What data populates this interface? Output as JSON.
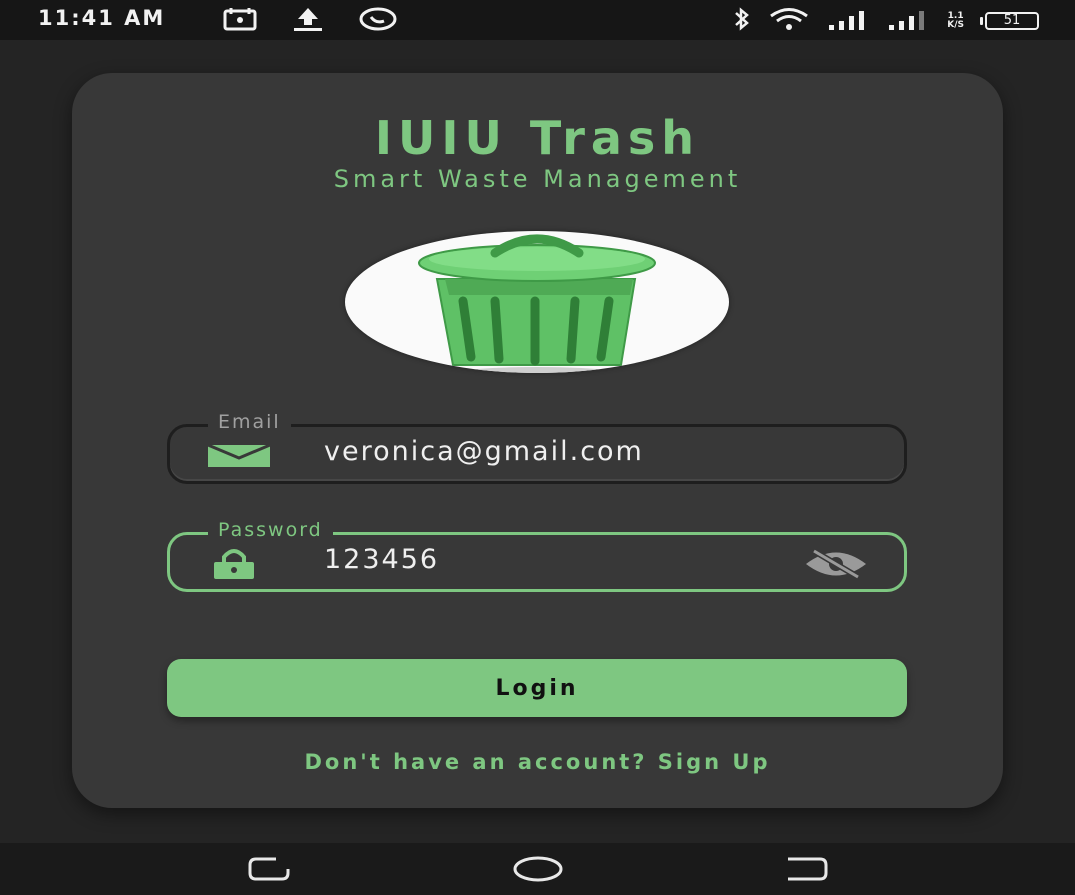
{
  "status_bar": {
    "time": "11:41 AM",
    "icons_left": [
      "calendar-icon",
      "upload-icon",
      "whatsapp-icon"
    ],
    "icons_right": [
      "bluetooth-icon",
      "wifi-icon",
      "signal-icon",
      "signal-icon"
    ],
    "net_speed_value": "1.1",
    "net_speed_unit": "K/S",
    "battery_level": "51"
  },
  "app": {
    "title": "IUIU Trash",
    "subtitle": "Smart Waste Management",
    "logo": "trash-bin-icon"
  },
  "form": {
    "email": {
      "label": "Email",
      "value": "veronica@gmail.com",
      "icon": "envelope-icon"
    },
    "password": {
      "label": "Password",
      "value": "123456",
      "icon": "lock-icon",
      "toggle_icon": "eye-off-icon"
    },
    "login_label": "Login",
    "signup_text": "Don't have an account? Sign Up"
  },
  "nav_bar": {
    "buttons": [
      "recent-apps-icon",
      "home-icon",
      "back-icon"
    ]
  },
  "colors": {
    "accent": "#7ec781",
    "card": "#383838",
    "background": "#242424"
  }
}
